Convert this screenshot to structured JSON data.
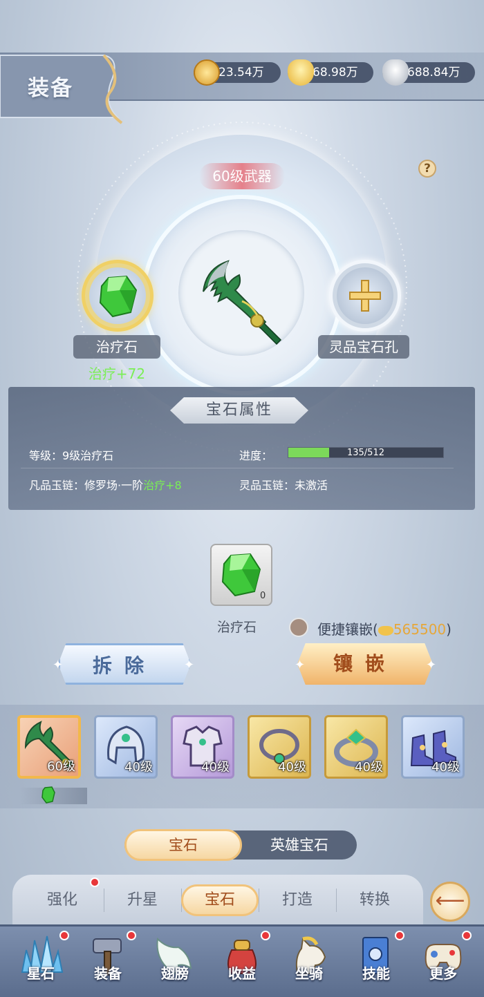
{
  "header": {
    "title": "装备"
  },
  "currencies": [
    {
      "name": "dragon-coin-icon",
      "value": "23.54万",
      "color": "#e4a83a"
    },
    {
      "name": "gold-ingot-icon",
      "value": "68.98万",
      "color": "#f1c34b"
    },
    {
      "name": "silver-ingot-icon",
      "value": "688.84万",
      "color": "#c9cfd8"
    }
  ],
  "help": {
    "label": "?"
  },
  "weapon": {
    "level_label": "60级武器"
  },
  "left_slot": {
    "name": "治疗石",
    "bonus": "治疗+72"
  },
  "right_slot": {
    "name": "灵品宝石孔",
    "icon": "plus-icon"
  },
  "attributes": {
    "title": "宝石属性",
    "level_label": "等级：9级治疗石",
    "progress_label": "进度：",
    "progress_text": "135/512",
    "progress_value": 135,
    "progress_max": 512,
    "mortal_chain_label": "凡品玉链：修罗场·一阶",
    "mortal_chain_bonus": "治疗+8",
    "spirit_chain_label": "灵品玉链：未激活"
  },
  "inventory": {
    "gem_name": "治疗石",
    "count": "0"
  },
  "quick_inlay": {
    "label": "便捷镶嵌(",
    "cost": "565500",
    "close": ")"
  },
  "buttons": {
    "remove": "拆除",
    "inlay": "镶嵌"
  },
  "equipment": [
    {
      "name": "weapon",
      "level": "60级",
      "selected": true
    },
    {
      "name": "helmet",
      "level": "40级"
    },
    {
      "name": "armor",
      "level": "40级"
    },
    {
      "name": "necklace",
      "level": "40级"
    },
    {
      "name": "ring",
      "level": "40级"
    },
    {
      "name": "boots",
      "level": "40级"
    }
  ],
  "sub_tabs": {
    "active": "宝石",
    "other": "英雄宝石"
  },
  "main_tabs": [
    {
      "label": "强化",
      "badge": true
    },
    {
      "label": "升星"
    },
    {
      "label": "宝石",
      "active": true
    },
    {
      "label": "打造"
    },
    {
      "label": "转换"
    }
  ],
  "bottom_nav": [
    {
      "label": "星石",
      "icon": "crystal-icon",
      "badge": true
    },
    {
      "label": "装备",
      "icon": "hammer-icon",
      "badge": true
    },
    {
      "label": "翅膀",
      "icon": "wing-icon",
      "badge": false
    },
    {
      "label": "收益",
      "icon": "money-bag-icon",
      "badge": true
    },
    {
      "label": "坐骑",
      "icon": "horse-icon",
      "badge": false
    },
    {
      "label": "技能",
      "icon": "skill-book-icon",
      "badge": true
    },
    {
      "label": "更多",
      "icon": "gamepad-icon",
      "badge": true
    }
  ]
}
